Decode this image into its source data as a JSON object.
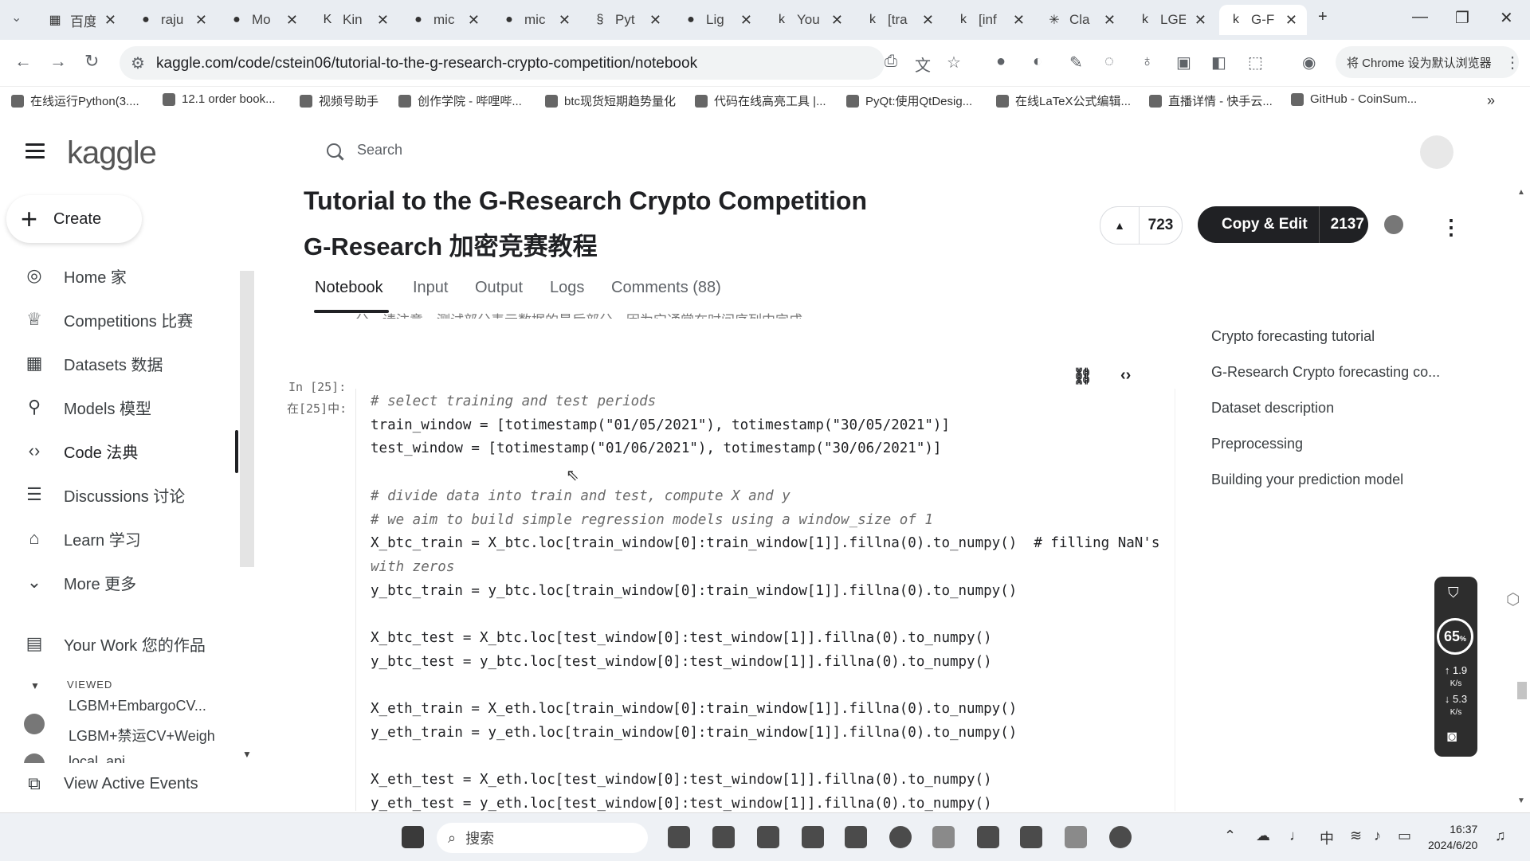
{
  "browser": {
    "tabs": [
      {
        "label": "百度",
        "icon": "baidu-icon"
      },
      {
        "label": "raju",
        "icon": "github-icon"
      },
      {
        "label": "Mo",
        "icon": "github-icon"
      },
      {
        "label": "Kin",
        "icon": "kaggle-k-icon"
      },
      {
        "label": "mic",
        "icon": "github-icon"
      },
      {
        "label": "mic",
        "icon": "github-icon"
      },
      {
        "label": "Pyt",
        "icon": "python-icon"
      },
      {
        "label": "Lig",
        "icon": "github-icon"
      },
      {
        "label": "You",
        "icon": "kaggle-icon"
      },
      {
        "label": "[tra",
        "icon": "kaggle-icon"
      },
      {
        "label": "[inf",
        "icon": "kaggle-icon"
      },
      {
        "label": "Cla",
        "icon": "claude-icon"
      },
      {
        "label": "LGE",
        "icon": "kaggle-icon"
      },
      {
        "label": "G-F",
        "icon": "kaggle-icon"
      }
    ],
    "url": "kaggle.com/code/cstein06/tutorial-to-the-g-research-crypto-competition/notebook",
    "default_browser_btn": "将 Chrome 设为默认浏览器",
    "bookmarks": [
      "在线运行Python(3....",
      "12.1 order book...",
      "视频号助手",
      "创作学院 - 哔哩哔...",
      "btc现货短期趋势量化",
      "代码在线高亮工具 |...",
      "PyQt:使用QtDesig...",
      "在线LaTeX公式编辑...",
      "直播详情 - 快手云...",
      "GitHub - CoinSum..."
    ]
  },
  "kaggle": {
    "logo": "kaggle",
    "search_placeholder": "Search",
    "create_label": "Create",
    "nav": [
      {
        "label": "Home 家",
        "icon": "compass-icon"
      },
      {
        "label": "Competitions 比赛",
        "icon": "trophy-icon"
      },
      {
        "label": "Datasets 数据",
        "icon": "table-icon"
      },
      {
        "label": "Models 模型",
        "icon": "models-icon"
      },
      {
        "label": "Code 法典",
        "icon": "code-icon"
      },
      {
        "label": "Discussions 讨论",
        "icon": "comment-icon"
      },
      {
        "label": "Learn 学习",
        "icon": "school-icon"
      },
      {
        "label": "More 更多",
        "icon": "chevron-down-icon"
      }
    ],
    "your_work": "Your Work 您的作品",
    "viewed_label": "VIEWED",
    "viewed_items": [
      "LGBM+EmbargoCV...",
      "LGBM+禁运CV+Weigh",
      "local_api"
    ],
    "view_active_events": "View Active Events"
  },
  "notebook": {
    "title_en": "Tutorial to the G-Research Crypto Competition",
    "title_zh": "G-Research 加密竞赛教程",
    "votes": "723",
    "copy_edit_label": "Copy & Edit",
    "copy_edit_count": "2137",
    "tabs": [
      "Notebook",
      "Input",
      "Output",
      "Logs",
      "Comments (88)"
    ],
    "cut_text": "分。请注意，测试部分表示数据的最后部分，因为它通常在时间序列中完成。",
    "cell_prompt_en": "In [25]:",
    "cell_prompt_zh": "在[25]中:",
    "code_lines": [
      {
        "text": "# select training and test periods",
        "comment": true
      },
      {
        "text": "train_window = [totimestamp(\"01/05/2021\"), totimestamp(\"30/05/2021\")]",
        "comment": false
      },
      {
        "text": "test_window = [totimestamp(\"01/06/2021\"), totimestamp(\"30/06/2021\")]",
        "comment": false
      },
      {
        "text": "",
        "comment": false
      },
      {
        "text": "# divide data into train and test, compute X and y",
        "comment": true
      },
      {
        "text": "# we aim to build simple regression models using a window_size of 1",
        "comment": true
      },
      {
        "text": "X_btc_train = X_btc.loc[train_window[0]:train_window[1]].fillna(0).to_numpy()  # filling NaN's",
        "comment": false
      },
      {
        "text": "with zeros",
        "comment": true
      },
      {
        "text": "y_btc_train = y_btc.loc[train_window[0]:train_window[1]].fillna(0).to_numpy()",
        "comment": false
      },
      {
        "text": "",
        "comment": false
      },
      {
        "text": "X_btc_test = X_btc.loc[test_window[0]:test_window[1]].fillna(0).to_numpy()",
        "comment": false
      },
      {
        "text": "y_btc_test = y_btc.loc[test_window[0]:test_window[1]].fillna(0).to_numpy()",
        "comment": false
      },
      {
        "text": "",
        "comment": false
      },
      {
        "text": "X_eth_train = X_eth.loc[train_window[0]:train_window[1]].fillna(0).to_numpy()",
        "comment": false
      },
      {
        "text": "y_eth_train = y_eth.loc[train_window[0]:train_window[1]].fillna(0).to_numpy()",
        "comment": false
      },
      {
        "text": "",
        "comment": false
      },
      {
        "text": "X_eth_test = X_eth.loc[test_window[0]:test_window[1]].fillna(0).to_numpy()",
        "comment": false
      },
      {
        "text": "y_eth_test = y_eth.loc[test_window[0]:test_window[1]].fillna(0).to_numpy()",
        "comment": false
      }
    ],
    "toc": [
      "Crypto forecasting tutorial",
      "G-Research Crypto forecasting co...",
      "Dataset description",
      "Preprocessing",
      "Building your prediction model"
    ]
  },
  "widget": {
    "percent": "65",
    "percent_unit": "%",
    "up_speed": "1.9",
    "down_speed": "5.3",
    "speed_unit": "K/s"
  },
  "taskbar": {
    "search_placeholder": "搜索",
    "ime": "中",
    "time": "16:37",
    "date": "2024/6/20"
  }
}
